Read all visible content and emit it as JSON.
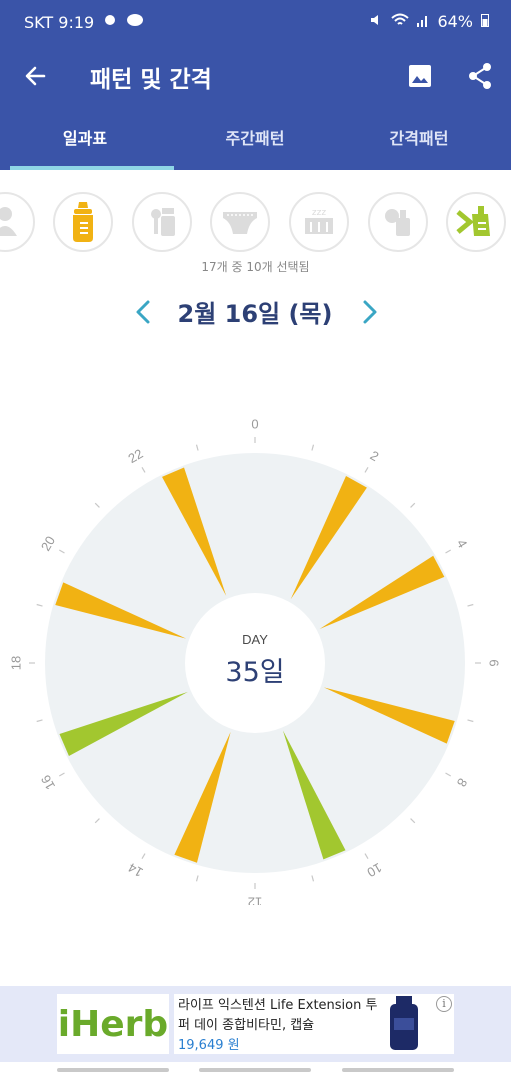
{
  "status": {
    "carrier_time": "SKT 9:19",
    "battery": "64%"
  },
  "appbar": {
    "title": "패턴 및 간격"
  },
  "tabs": [
    {
      "label": "일과표",
      "active": true
    },
    {
      "label": "주간패턴",
      "active": false
    },
    {
      "label": "간격패턴",
      "active": false
    }
  ],
  "category_icons": [
    "baby-icon",
    "bottle-icon",
    "baby-food-icon",
    "diaper-icon",
    "sleep-icon",
    "breast-pump-icon",
    "pumping-icon"
  ],
  "selected_count": "17개 중 10개 선택됨",
  "date": "2월 16일 (목)",
  "clock": {
    "day_label": "DAY",
    "day_value": "35일",
    "hour_labels": [
      "0",
      "2",
      "4",
      "6",
      "8",
      "10",
      "12",
      "14",
      "16",
      "18",
      "20",
      "22"
    ],
    "events": [
      {
        "hour": 1.95,
        "kind": "feeding"
      },
      {
        "hour": 4.15,
        "kind": "feeding"
      },
      {
        "hour": 7.3,
        "kind": "feeding"
      },
      {
        "hour": 10.5,
        "kind": "other"
      },
      {
        "hour": 13.3,
        "kind": "feeding"
      },
      {
        "hour": 16.45,
        "kind": "other"
      },
      {
        "hour": 19.3,
        "kind": "feeding"
      },
      {
        "hour": 22.45,
        "kind": "feeding"
      }
    ],
    "colors": {
      "feeding": "#f1b213",
      "other": "#a2c72f",
      "face": "#eef2f4"
    }
  },
  "ad": {
    "brand": "iHerb",
    "title": "라이프 익스텐션 Life Extension 투 퍼 데이 종합비타민, 캡슐",
    "price": "19,649 원",
    "info": "i"
  }
}
